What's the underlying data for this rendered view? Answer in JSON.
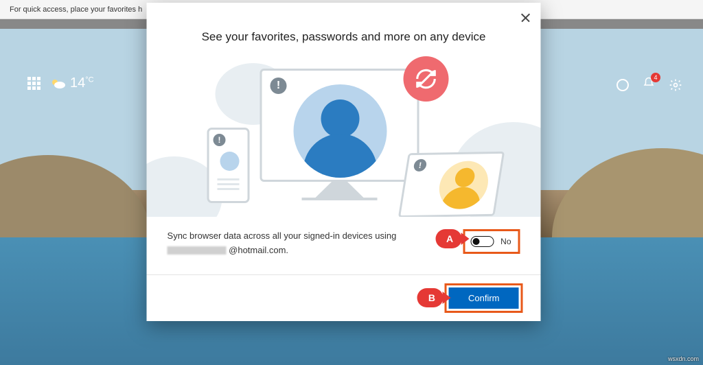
{
  "favorites_hint": "For quick access, place your favorites h",
  "header": {
    "temperature": "14",
    "temp_unit": "°C",
    "notification_count": "4"
  },
  "dialog": {
    "title": "See your favorites, passwords and more on any device",
    "sync_text": "Sync browser data across all your signed-in devices using",
    "email_suffix": "@hotmail.com.",
    "toggle_label": "No",
    "confirm_label": "Confirm"
  },
  "callouts": {
    "a": "A",
    "b": "B"
  },
  "watermark": "wsxdn.com"
}
